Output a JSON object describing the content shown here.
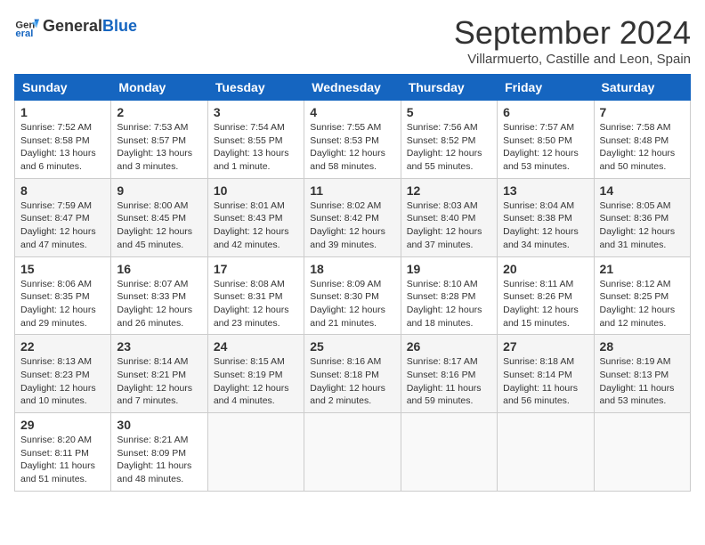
{
  "logo": {
    "general": "General",
    "blue": "Blue"
  },
  "header": {
    "month": "September 2024",
    "location": "Villarmuerto, Castille and Leon, Spain"
  },
  "weekdays": [
    "Sunday",
    "Monday",
    "Tuesday",
    "Wednesday",
    "Thursday",
    "Friday",
    "Saturday"
  ],
  "weeks": [
    [
      {
        "day": "1",
        "sunrise": "Sunrise: 7:52 AM",
        "sunset": "Sunset: 8:58 PM",
        "daylight": "Daylight: 13 hours and 6 minutes."
      },
      {
        "day": "2",
        "sunrise": "Sunrise: 7:53 AM",
        "sunset": "Sunset: 8:57 PM",
        "daylight": "Daylight: 13 hours and 3 minutes."
      },
      {
        "day": "3",
        "sunrise": "Sunrise: 7:54 AM",
        "sunset": "Sunset: 8:55 PM",
        "daylight": "Daylight: 13 hours and 1 minute."
      },
      {
        "day": "4",
        "sunrise": "Sunrise: 7:55 AM",
        "sunset": "Sunset: 8:53 PM",
        "daylight": "Daylight: 12 hours and 58 minutes."
      },
      {
        "day": "5",
        "sunrise": "Sunrise: 7:56 AM",
        "sunset": "Sunset: 8:52 PM",
        "daylight": "Daylight: 12 hours and 55 minutes."
      },
      {
        "day": "6",
        "sunrise": "Sunrise: 7:57 AM",
        "sunset": "Sunset: 8:50 PM",
        "daylight": "Daylight: 12 hours and 53 minutes."
      },
      {
        "day": "7",
        "sunrise": "Sunrise: 7:58 AM",
        "sunset": "Sunset: 8:48 PM",
        "daylight": "Daylight: 12 hours and 50 minutes."
      }
    ],
    [
      {
        "day": "8",
        "sunrise": "Sunrise: 7:59 AM",
        "sunset": "Sunset: 8:47 PM",
        "daylight": "Daylight: 12 hours and 47 minutes."
      },
      {
        "day": "9",
        "sunrise": "Sunrise: 8:00 AM",
        "sunset": "Sunset: 8:45 PM",
        "daylight": "Daylight: 12 hours and 45 minutes."
      },
      {
        "day": "10",
        "sunrise": "Sunrise: 8:01 AM",
        "sunset": "Sunset: 8:43 PM",
        "daylight": "Daylight: 12 hours and 42 minutes."
      },
      {
        "day": "11",
        "sunrise": "Sunrise: 8:02 AM",
        "sunset": "Sunset: 8:42 PM",
        "daylight": "Daylight: 12 hours and 39 minutes."
      },
      {
        "day": "12",
        "sunrise": "Sunrise: 8:03 AM",
        "sunset": "Sunset: 8:40 PM",
        "daylight": "Daylight: 12 hours and 37 minutes."
      },
      {
        "day": "13",
        "sunrise": "Sunrise: 8:04 AM",
        "sunset": "Sunset: 8:38 PM",
        "daylight": "Daylight: 12 hours and 34 minutes."
      },
      {
        "day": "14",
        "sunrise": "Sunrise: 8:05 AM",
        "sunset": "Sunset: 8:36 PM",
        "daylight": "Daylight: 12 hours and 31 minutes."
      }
    ],
    [
      {
        "day": "15",
        "sunrise": "Sunrise: 8:06 AM",
        "sunset": "Sunset: 8:35 PM",
        "daylight": "Daylight: 12 hours and 29 minutes."
      },
      {
        "day": "16",
        "sunrise": "Sunrise: 8:07 AM",
        "sunset": "Sunset: 8:33 PM",
        "daylight": "Daylight: 12 hours and 26 minutes."
      },
      {
        "day": "17",
        "sunrise": "Sunrise: 8:08 AM",
        "sunset": "Sunset: 8:31 PM",
        "daylight": "Daylight: 12 hours and 23 minutes."
      },
      {
        "day": "18",
        "sunrise": "Sunrise: 8:09 AM",
        "sunset": "Sunset: 8:30 PM",
        "daylight": "Daylight: 12 hours and 21 minutes."
      },
      {
        "day": "19",
        "sunrise": "Sunrise: 8:10 AM",
        "sunset": "Sunset: 8:28 PM",
        "daylight": "Daylight: 12 hours and 18 minutes."
      },
      {
        "day": "20",
        "sunrise": "Sunrise: 8:11 AM",
        "sunset": "Sunset: 8:26 PM",
        "daylight": "Daylight: 12 hours and 15 minutes."
      },
      {
        "day": "21",
        "sunrise": "Sunrise: 8:12 AM",
        "sunset": "Sunset: 8:25 PM",
        "daylight": "Daylight: 12 hours and 12 minutes."
      }
    ],
    [
      {
        "day": "22",
        "sunrise": "Sunrise: 8:13 AM",
        "sunset": "Sunset: 8:23 PM",
        "daylight": "Daylight: 12 hours and 10 minutes."
      },
      {
        "day": "23",
        "sunrise": "Sunrise: 8:14 AM",
        "sunset": "Sunset: 8:21 PM",
        "daylight": "Daylight: 12 hours and 7 minutes."
      },
      {
        "day": "24",
        "sunrise": "Sunrise: 8:15 AM",
        "sunset": "Sunset: 8:19 PM",
        "daylight": "Daylight: 12 hours and 4 minutes."
      },
      {
        "day": "25",
        "sunrise": "Sunrise: 8:16 AM",
        "sunset": "Sunset: 8:18 PM",
        "daylight": "Daylight: 12 hours and 2 minutes."
      },
      {
        "day": "26",
        "sunrise": "Sunrise: 8:17 AM",
        "sunset": "Sunset: 8:16 PM",
        "daylight": "Daylight: 11 hours and 59 minutes."
      },
      {
        "day": "27",
        "sunrise": "Sunrise: 8:18 AM",
        "sunset": "Sunset: 8:14 PM",
        "daylight": "Daylight: 11 hours and 56 minutes."
      },
      {
        "day": "28",
        "sunrise": "Sunrise: 8:19 AM",
        "sunset": "Sunset: 8:13 PM",
        "daylight": "Daylight: 11 hours and 53 minutes."
      }
    ],
    [
      {
        "day": "29",
        "sunrise": "Sunrise: 8:20 AM",
        "sunset": "Sunset: 8:11 PM",
        "daylight": "Daylight: 11 hours and 51 minutes."
      },
      {
        "day": "30",
        "sunrise": "Sunrise: 8:21 AM",
        "sunset": "Sunset: 8:09 PM",
        "daylight": "Daylight: 11 hours and 48 minutes."
      },
      null,
      null,
      null,
      null,
      null
    ]
  ]
}
